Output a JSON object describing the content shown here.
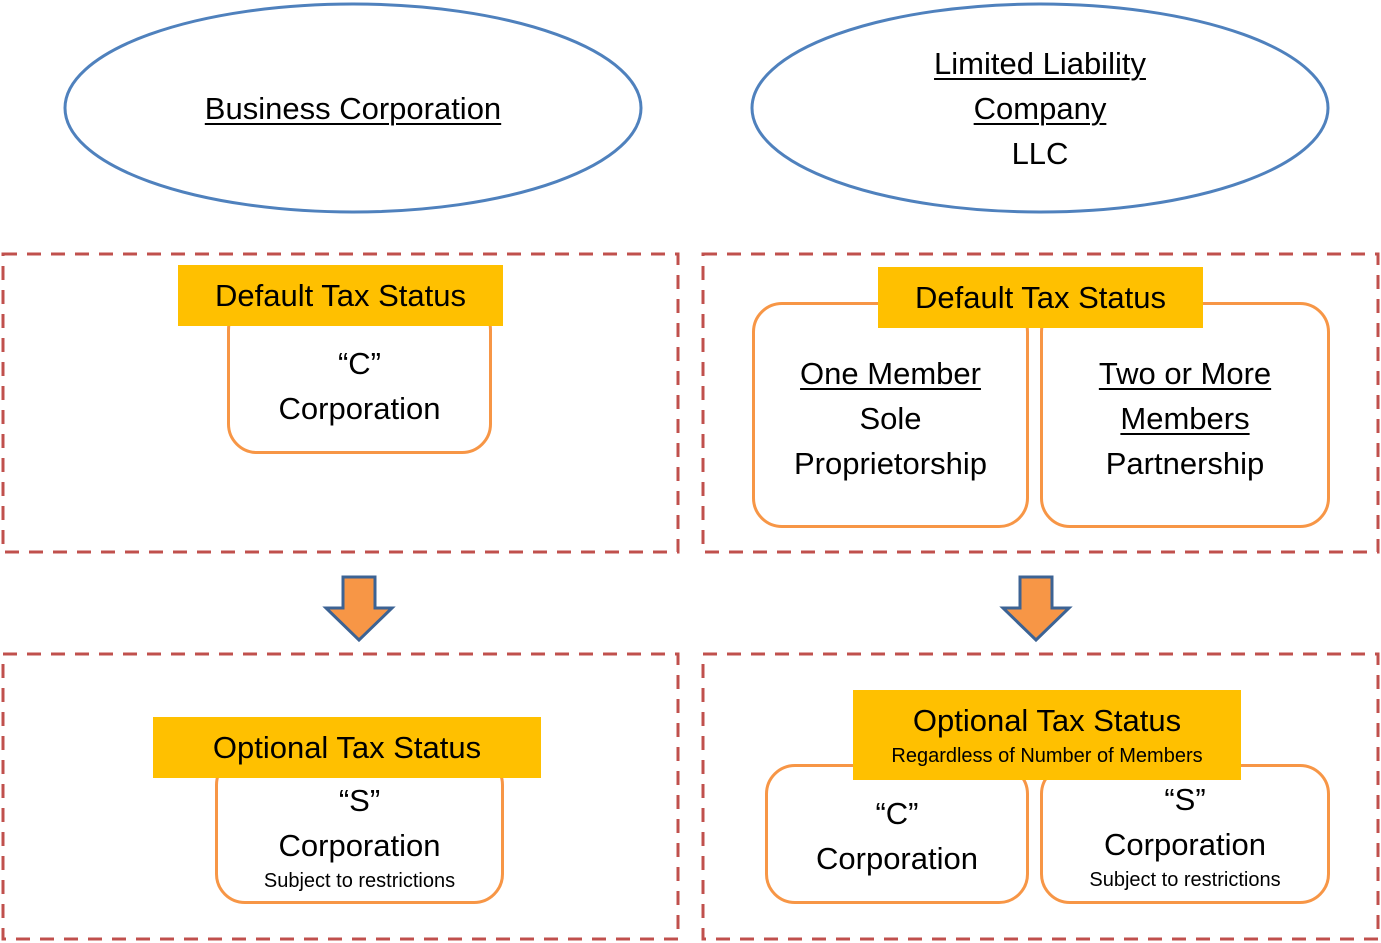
{
  "entities": {
    "corporation": {
      "title": "Business Corporation"
    },
    "llc": {
      "title_line1": "Limited Liability",
      "title_line2": "Company",
      "abbr": "LLC"
    }
  },
  "corporation": {
    "default_label": "Default Tax Status",
    "default_box": {
      "line1": "“C”",
      "line2": "Corporation"
    },
    "optional_label": "Optional Tax Status",
    "optional_box": {
      "line1": "“S”",
      "line2": "Corporation",
      "note": "Subject to restrictions"
    }
  },
  "llc": {
    "default_label": "Default Tax Status",
    "one_member": {
      "heading": "One Member",
      "line1": "Sole",
      "line2": "Proprietorship"
    },
    "multi_member": {
      "heading1": "Two or More",
      "heading2": "Members",
      "line1": "Partnership"
    },
    "optional_label": "Optional Tax Status",
    "optional_sublabel": "Regardless of Number of Members",
    "c_box": {
      "line1": "“C”",
      "line2": "Corporation"
    },
    "s_box": {
      "line1": "“S”",
      "line2": "Corporation",
      "note": "Subject to restrictions"
    }
  },
  "icons": {
    "arrow": "down-arrow-icon"
  },
  "colors": {
    "ellipse_stroke": "#4F81BD",
    "dashed_border": "#C0504D",
    "label_fill": "#FFC000",
    "box_stroke": "#F79646",
    "arrow_fill": "#F79646",
    "arrow_stroke": "#3C6394"
  }
}
